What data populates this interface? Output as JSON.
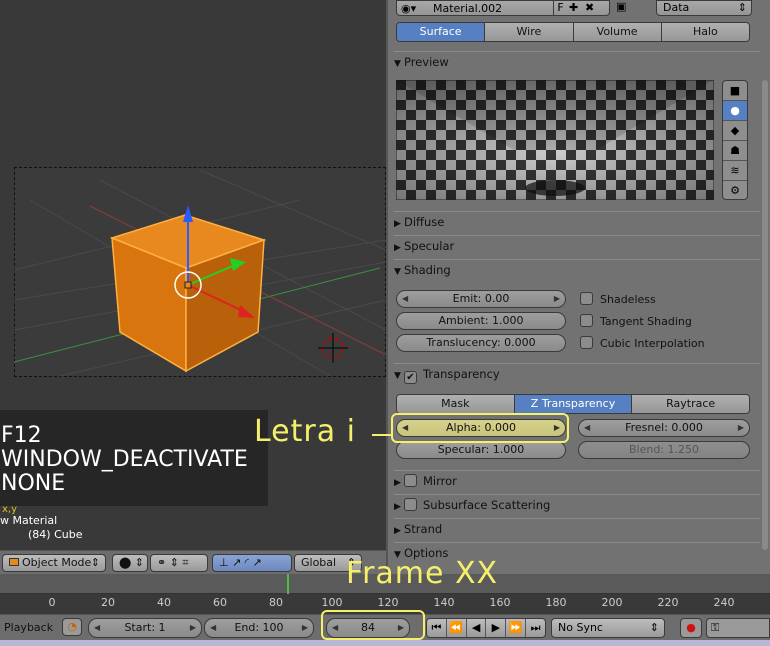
{
  "viewport": {
    "keyinfo": [
      "F12",
      "WINDOW_DEACTIVATE",
      "NONE"
    ],
    "axis_label": "x,y",
    "material_text": "w Material",
    "object_text": "(84) Cube",
    "header": {
      "mode": "Object Mode",
      "orientation": "Global"
    }
  },
  "properties": {
    "material_name": "Material.002",
    "fake_user": "F",
    "data_select": "Data",
    "tabs": [
      "Surface",
      "Wire",
      "Volume",
      "Halo"
    ],
    "active_tab": "Surface",
    "panels": {
      "preview": "Preview",
      "diffuse": "Diffuse",
      "specular": "Specular",
      "shading": "Shading",
      "transparency": "Transparency",
      "mirror": "Mirror",
      "sss": "Subsurface Scattering",
      "strand": "Strand",
      "options": "Options"
    },
    "shading": {
      "emit": "Emit: 0.00",
      "ambient": "Ambient: 1.000",
      "translucency": "Translucency: 0.000",
      "shadeless": "Shadeless",
      "tangent": "Tangent Shading",
      "cubic": "Cubic Interpolation"
    },
    "transparency": {
      "modes": [
        "Mask",
        "Z Transparency",
        "Raytrace"
      ],
      "active_mode": "Z Transparency",
      "alpha": "Alpha: 0.000",
      "fresnel": "Fresnel: 0.000",
      "specular": "Specular: 1.000",
      "blend": "Blend: 1.250"
    }
  },
  "timeline": {
    "ticks": [
      "0",
      "20",
      "40",
      "60",
      "80",
      "100",
      "120",
      "140",
      "160",
      "180",
      "200",
      "220",
      "240"
    ],
    "current_frame_marker": 84,
    "playback": "Playback",
    "start": "Start: 1",
    "end": "End: 100",
    "current_frame": "84",
    "sync": "No Sync"
  },
  "annotations": {
    "letra": "Letra i",
    "frame": "Frame XX"
  },
  "colors": {
    "accent": "#5680c2",
    "annotation": "#f5f06a",
    "cube": "#e07a10"
  }
}
